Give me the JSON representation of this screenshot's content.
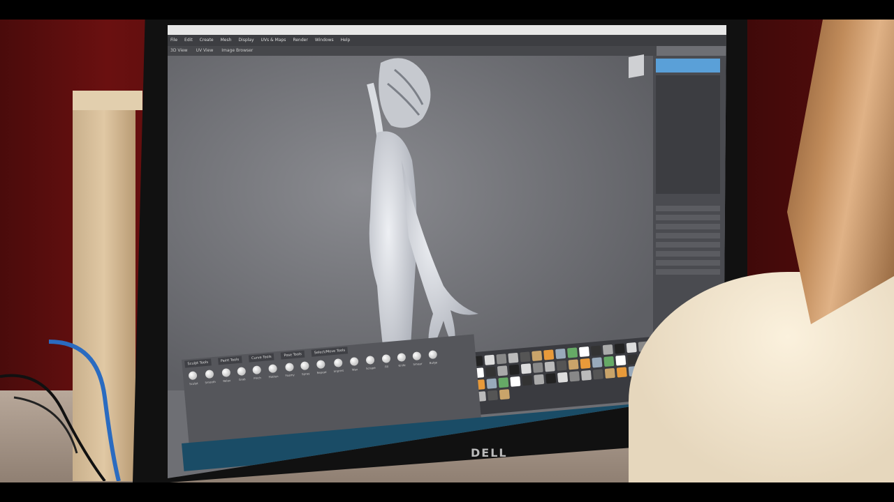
{
  "scene": {
    "monitor_brand": "DELL",
    "app": {
      "menu": [
        "File",
        "Edit",
        "Create",
        "Mesh",
        "Display",
        "UVs & Maps",
        "Render",
        "Windows",
        "Help"
      ],
      "view_tabs": [
        "3D View",
        "UV View",
        "Image Browser"
      ],
      "shelf_tabs": [
        "Sculpt Tools",
        "Paint Tools",
        "Curve Tools",
        "Pose Tools",
        "Select/Move Tools"
      ],
      "tools": [
        "Sculpt",
        "Smooth",
        "Relax",
        "Grab",
        "Pinch",
        "Flatten",
        "Foamy",
        "Spray",
        "Repeat",
        "Imprint",
        "Wax",
        "Scrape",
        "Fill",
        "Knife",
        "Smear",
        "Bulge"
      ]
    }
  }
}
